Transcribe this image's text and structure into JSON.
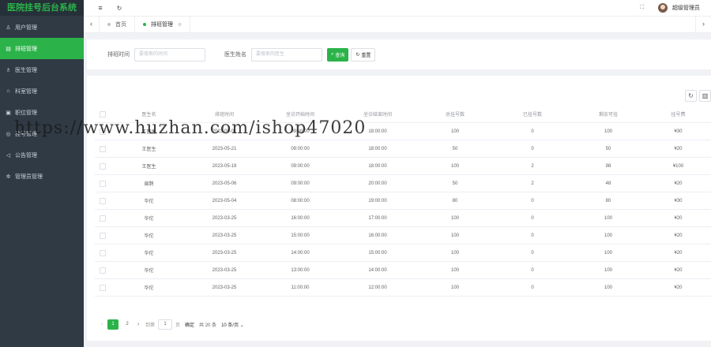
{
  "app": {
    "title": "医院挂号后台系统"
  },
  "sidebar": {
    "items": [
      {
        "label": "用户管理",
        "icon": "user-icon",
        "glyph": "♙"
      },
      {
        "label": "排班管理",
        "icon": "calendar-icon",
        "glyph": "▤"
      },
      {
        "label": "医生管理",
        "icon": "doctor-icon",
        "glyph": "♗"
      },
      {
        "label": "科室管理",
        "icon": "home-icon",
        "glyph": "⌂"
      },
      {
        "label": "职位管理",
        "icon": "briefcase-icon",
        "glyph": "▣"
      },
      {
        "label": "挂号管理",
        "icon": "register-icon",
        "glyph": "◎"
      },
      {
        "label": "公告管理",
        "icon": "notice-icon",
        "glyph": "◁"
      },
      {
        "label": "管理员管理",
        "icon": "settings-icon",
        "glyph": "✲"
      }
    ],
    "active_index": 1,
    "accent": "#2bb34a",
    "bg": "#2f3a45"
  },
  "header": {
    "menu_glyph": "≡",
    "refresh_glyph": "↻",
    "fullscreen_glyph": "⛶",
    "admin_name": "超级管理员"
  },
  "tabs": {
    "prev_glyph": "‹",
    "next_glyph": "›",
    "items": [
      {
        "label": "首页",
        "active": false
      },
      {
        "label": "排班管理",
        "active": true,
        "close_glyph": "⊗"
      }
    ]
  },
  "search": {
    "schedule_time_label": "排班时间",
    "schedule_time_placeholder": "要搜索的时间",
    "doctor_name_label": "医生姓名",
    "doctor_name_placeholder": "要搜索的医生",
    "search_button": "查询",
    "search_glyph": "⌕",
    "reset_button": "重置",
    "reset_glyph": "↻"
  },
  "toolbar": {
    "refresh_glyph": "↻",
    "extra_glyph": "▥"
  },
  "table": {
    "columns": [
      "医生名",
      "排班时间",
      "坐诊开始时间",
      "坐诊结束时间",
      "总挂号数",
      "已挂号数",
      "剩余可挂",
      "挂号费"
    ],
    "rows": [
      [
        "王医生",
        "2023-06-01",
        "09:00:00",
        "18:00:00",
        "100",
        "0",
        "100",
        "¥30"
      ],
      [
        "王医生",
        "2023-05-21",
        "09:00:00",
        "18:00:00",
        "50",
        "0",
        "50",
        "¥20"
      ],
      [
        "王医生",
        "2023-05-19",
        "09:00:00",
        "18:00:00",
        "100",
        "2",
        "98",
        "¥100"
      ],
      [
        "扁鹊",
        "2023-05-06",
        "09:00:00",
        "20:00:00",
        "50",
        "2",
        "48",
        "¥20"
      ],
      [
        "华佗",
        "2023-05-04",
        "08:00:00",
        "19:00:00",
        "80",
        "0",
        "80",
        "¥30"
      ],
      [
        "华佗",
        "2023-03-25",
        "16:00:00",
        "17:00:00",
        "100",
        "0",
        "100",
        "¥20"
      ],
      [
        "华佗",
        "2023-03-25",
        "15:00:00",
        "16:00:00",
        "100",
        "0",
        "100",
        "¥20"
      ],
      [
        "华佗",
        "2023-03-25",
        "14:00:00",
        "15:00:00",
        "100",
        "0",
        "100",
        "¥20"
      ],
      [
        "华佗",
        "2023-03-25",
        "13:00:00",
        "14:00:00",
        "100",
        "0",
        "100",
        "¥20"
      ],
      [
        "华佗",
        "2023-03-25",
        "11:00:00",
        "12:00:00",
        "100",
        "0",
        "100",
        "¥20"
      ]
    ]
  },
  "pager": {
    "prev_glyph": "‹",
    "next_glyph": "›",
    "pages": [
      "1",
      "2"
    ],
    "current": "1",
    "goto_label": "到第",
    "goto_value": "1",
    "page_unit": "页",
    "confirm": "确定",
    "total": "共 20 条",
    "page_size": "10 条/页 ⌄"
  },
  "watermark": {
    "text": "https://www.huzhan.com/ishop47020"
  }
}
